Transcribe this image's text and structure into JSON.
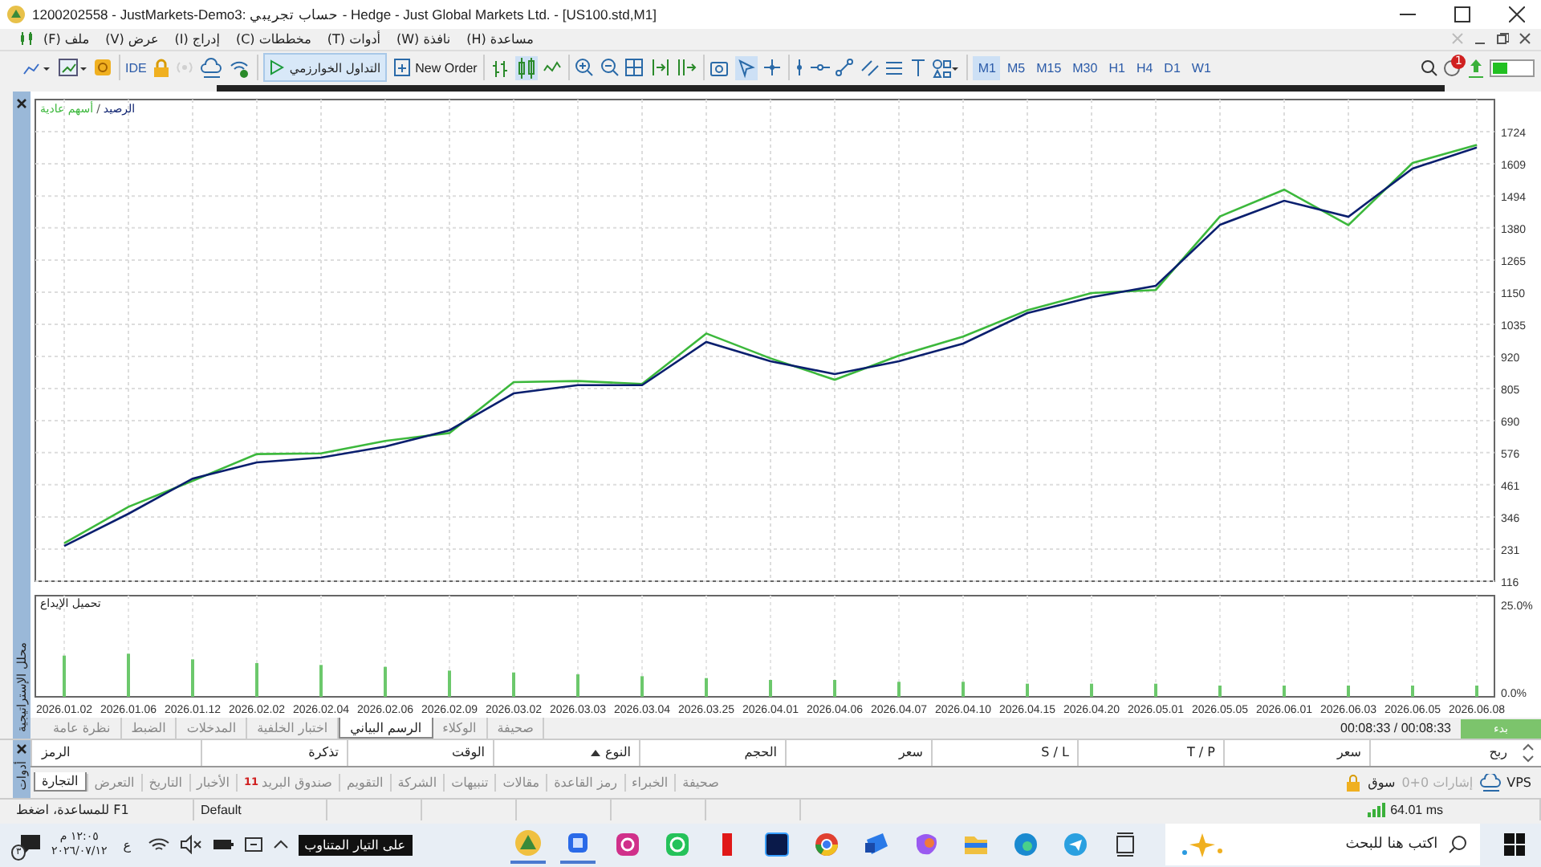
{
  "window": {
    "title": "1200202558 - JustMarkets-Demo3: حساب تجريبي - Hedge - Just Global Markets Ltd. - [US100.std,M1]"
  },
  "menu": [
    {
      "label": "مساعدة (H)"
    },
    {
      "label": "نافذة (W)"
    },
    {
      "label": "أدوات (T)"
    },
    {
      "label": "مخططات (C)"
    },
    {
      "label": "إدراج (I)"
    },
    {
      "label": "عرض (V)"
    },
    {
      "label": "ملف (F)"
    }
  ],
  "toolbar": {
    "ide": "IDE",
    "algo_trading": {
      "label": "التداول الخوارزمي",
      "on": true
    },
    "new_order": "New Order",
    "notifications": "1",
    "timeframes": [
      {
        "label": "W1",
        "selected": false
      },
      {
        "label": "D1",
        "selected": false
      },
      {
        "label": "H4",
        "selected": false
      },
      {
        "label": "H1",
        "selected": false
      },
      {
        "label": "M30",
        "selected": false
      },
      {
        "label": "M15",
        "selected": false
      },
      {
        "label": "M5",
        "selected": false
      },
      {
        "label": "M1",
        "selected": true
      }
    ]
  },
  "strategy_tester": {
    "side_title": "محلل الإستراتيجية",
    "chart": {
      "legend_separator": "/",
      "chart_data": {
        "type": "line",
        "grid": true,
        "ylim": [
          116,
          1839
        ],
        "yticks": [
          116,
          231,
          346,
          461,
          576,
          690,
          805,
          920,
          1035,
          1150,
          1265,
          1380,
          1494,
          1609,
          1724
        ],
        "series": [
          {
            "name": "الرصيد",
            "color": "#0a1f6e",
            "values": [
              242,
              357,
              483,
              541,
              558,
              598,
              656,
              788,
              817,
              817,
              972,
              903,
              857,
              903,
              966,
              1075,
              1132,
              1173,
              1391,
              1477,
              1420,
              1592,
              1667
            ]
          },
          {
            "name": "أسهم عادية",
            "color": "#3cb83c",
            "values": [
              252,
              382,
              475,
              571,
              573,
              618,
              646,
              828,
              832,
              822,
              1002,
              913,
              837,
              923,
              991,
              1085,
              1147,
              1158,
              1421,
              1517,
              1390,
              1612,
              1677
            ]
          }
        ]
      }
    },
    "load_chart": {
      "chart_data": {
        "type": "bar",
        "grid": true,
        "categories": [
          "2026.01.02",
          "2026.01.06",
          "2026.01.12",
          "2026.02.02",
          "2026.02.04",
          "2026.02.06",
          "2026.02.09",
          "2026.03.02",
          "2026.03.03",
          "2026.03.04",
          "2026.03.25",
          "2026.04.01",
          "2026.04.06",
          "2026.04.07",
          "2026.04.10",
          "2026.04.15",
          "2026.04.20",
          "2026.05.01",
          "2026.05.05",
          "2026.06.01",
          "2026.06.03",
          "2026.06.05",
          "2026.06.08"
        ],
        "ylim": [
          0,
          27
        ],
        "yticks": [
          {
            "value": 0,
            "label": "0.0%"
          },
          {
            "value": 25,
            "label": "25.0%"
          }
        ],
        "series": [
          {
            "name": "تحميل الإيداع",
            "color": "#6cc86c",
            "values": [
              11,
              11.5,
              10,
              9,
              8.5,
              8,
              7,
              6.5,
              6,
              5.5,
              5,
              4.5,
              4.5,
              4,
              4,
              3.5,
              3.5,
              3.5,
              3,
              3,
              3,
              3,
              3
            ]
          }
        ]
      }
    },
    "tabs": [
      {
        "label": "صحيفة",
        "selected": false
      },
      {
        "label": "الوكلاء",
        "selected": false
      },
      {
        "label": "الرسم البياني",
        "selected": true
      },
      {
        "label": "اختبار الخلفية",
        "selected": false
      },
      {
        "label": "المدخلات",
        "selected": false
      },
      {
        "label": "الضبط",
        "selected": false
      },
      {
        "label": "نظرة عامة",
        "selected": false
      }
    ],
    "timer": "00:08:33 / 00:08:33",
    "start_button": "بدء"
  },
  "toolbox": {
    "side_title": "أدوات",
    "columns": [
      {
        "label": "ربح",
        "sorted": false
      },
      {
        "label": "سعر",
        "sorted": false
      },
      {
        "label": "T / P",
        "sorted": false
      },
      {
        "label": "S / L",
        "sorted": false
      },
      {
        "label": "سعر",
        "sorted": false
      },
      {
        "label": "الحجم",
        "sorted": false
      },
      {
        "label": "النوع",
        "sorted": true
      },
      {
        "label": "الوقت",
        "sorted": false
      },
      {
        "label": "تذكرة",
        "sorted": false
      },
      {
        "label": "الرمز",
        "sorted": false
      }
    ],
    "tabs": [
      {
        "label": "صحيفة",
        "selected": false
      },
      {
        "label": "الخبراء",
        "selected": false
      },
      {
        "label": "رمز القاعدة",
        "selected": false
      },
      {
        "label": "مقالات",
        "selected": false
      },
      {
        "label": "تنبيهات",
        "selected": false
      },
      {
        "label": "الشركة",
        "selected": false
      },
      {
        "label": "التقويم",
        "selected": false
      },
      {
        "label": "صندوق البريد",
        "selected": false,
        "badge": "11"
      },
      {
        "label": "الأخبار",
        "selected": false
      },
      {
        "label": "التاريخ",
        "selected": false
      },
      {
        "label": "التعرض",
        "selected": false
      },
      {
        "label": "التجارة",
        "selected": true
      }
    ],
    "market": "سوق",
    "signals": {
      "label": "إشارات 0+0",
      "disabled": true
    },
    "vps": "VPS"
  },
  "status_bar": {
    "help": "F1 للمساعدة، اضغط",
    "profile": "Default",
    "ping": "64.01 ms"
  },
  "taskbar": {
    "search_placeholder": "اكتب هنا للبحث",
    "tooltip": "على التيار المتناوب",
    "language": "ع",
    "time": "١٢:٠٥ م",
    "date": "٢٠٢٦/٠٧/١٢",
    "notification_count": "٣"
  }
}
